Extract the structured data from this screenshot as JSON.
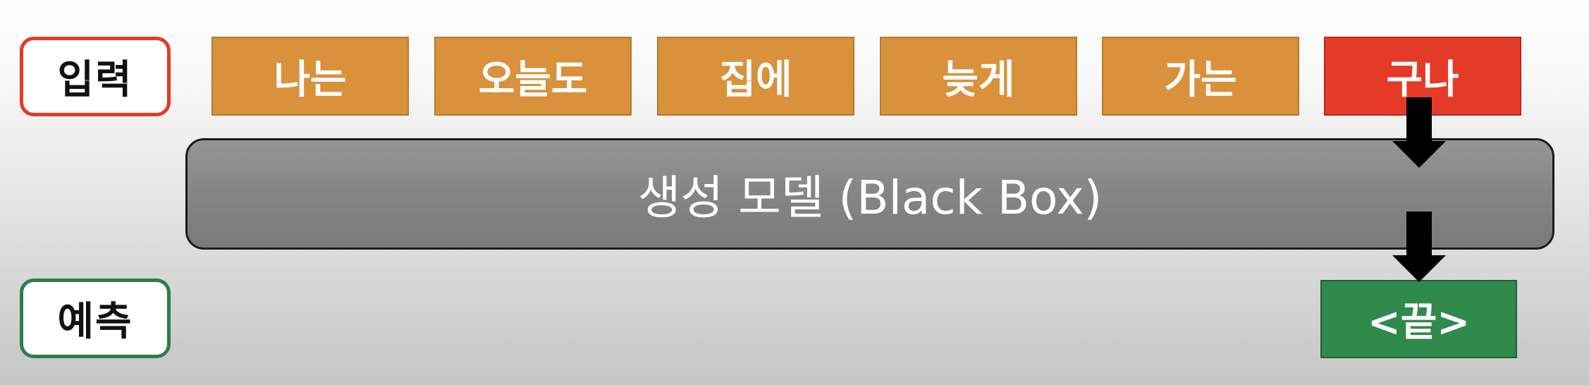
{
  "input_label": {
    "text": "입력",
    "border_color": "#e63a28"
  },
  "prediction_label": {
    "text": "예측",
    "border_color": "#2e7d4a"
  },
  "input_tokens": [
    {
      "text": "나는",
      "color": "#d9913c"
    },
    {
      "text": "오늘도",
      "color": "#d9913c"
    },
    {
      "text": "집에",
      "color": "#d9913c"
    },
    {
      "text": "늦게",
      "color": "#d9913c"
    },
    {
      "text": "가는",
      "color": "#d9913c"
    },
    {
      "text": "구나",
      "color": "#e63a28"
    }
  ],
  "model": {
    "text": "생성 모델 (Black Box)"
  },
  "prediction": {
    "text": "<끝>",
    "color": "#2f8a4c"
  }
}
